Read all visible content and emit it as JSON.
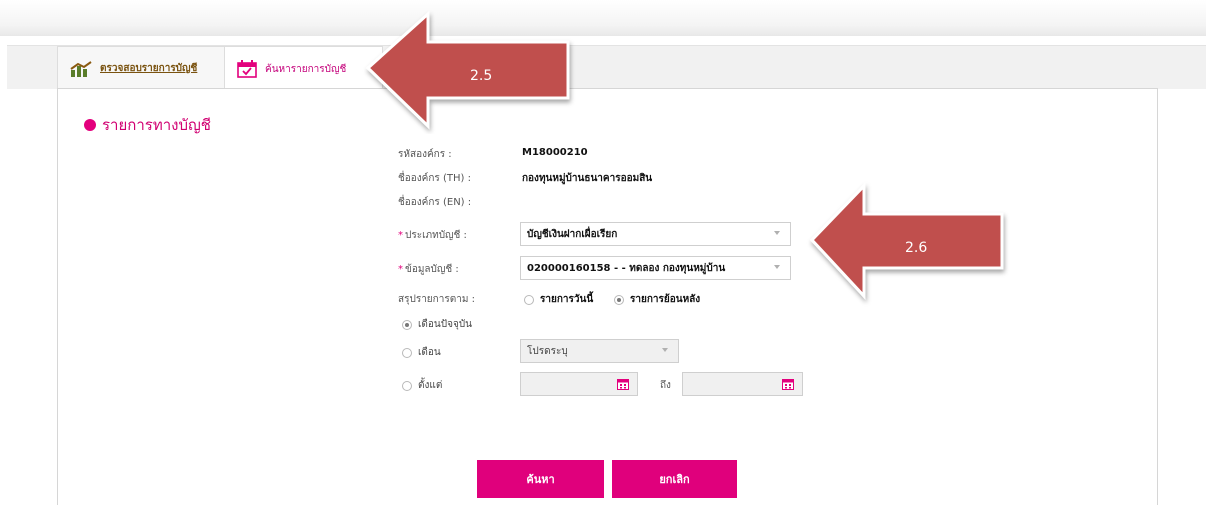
{
  "tabs": [
    {
      "label": "ตรวจสอบรายการบัญชี",
      "icon": "bar-chart-icon"
    },
    {
      "label": "ค้นหารายการบัญชี",
      "icon": "calendar-check-icon"
    }
  ],
  "section_title": "รายการทางบัญชี",
  "form": {
    "org_code_label": "รหัสองค์กร :",
    "org_code_value": "M18000210",
    "org_name_th_label": "ชื่อองค์กร (TH) :",
    "org_name_th_value": "กองทุนหมู่บ้านธนาคารออมสิน",
    "org_name_en_label": "ชื่อองค์กร (EN) :",
    "org_name_en_value": "",
    "account_type_label": "ประเภทบัญชี :",
    "account_type_value": "บัญชีเงินฝากเผื่อเรียก",
    "account_info_label": "ข้อมูลบัญชี :",
    "account_info_value": "020000160158 - - ทดลอง กองทุนหมู่บ้าน",
    "summary_label": "สรุปรายการตาม :",
    "summary_options": [
      "รายการวันนี้",
      "รายการย้อนหลัง"
    ],
    "summary_selected": "รายการย้อนหลัง",
    "period_options": {
      "current_month": "เดือนปัจจุบัน",
      "month": "เดือน",
      "from": "ตั้งแต่"
    },
    "period_selected": "เดือนปัจจุบัน",
    "month_select_value": "โปรดระบุ",
    "to_label": "ถึง"
  },
  "buttons": {
    "search": "ค้นหา",
    "cancel": "ยกเลิก"
  },
  "callouts": {
    "first": "2.5",
    "second": "2.6"
  },
  "colors": {
    "accent": "#e0007c",
    "tab_link": "#7a5310",
    "callout": "#c0504d"
  }
}
